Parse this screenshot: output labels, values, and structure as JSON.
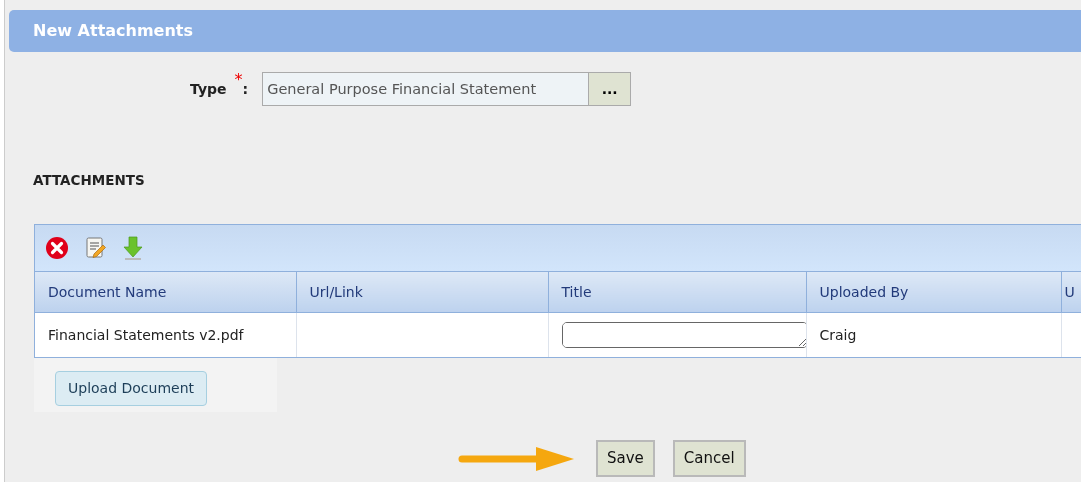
{
  "panel": {
    "title": "New Attachments"
  },
  "type_field": {
    "label": "Type",
    "required_mark": "*",
    "colon": ":",
    "value": "General Purpose Financial Statement",
    "browse_button": "..."
  },
  "attachments": {
    "heading": "ATTACHMENTS",
    "toolbar": [
      {
        "kind": "delete"
      },
      {
        "kind": "edit"
      },
      {
        "kind": "download"
      }
    ],
    "columns": [
      "Document Name",
      "Url/Link",
      "Title",
      "Uploaded By",
      "U"
    ],
    "rows": [
      {
        "document_name": "Financial Statements v2.pdf",
        "url": "",
        "title": "",
        "uploaded_by": "Craig"
      }
    ],
    "upload_button": "Upload Document"
  },
  "buttons": [
    "Save",
    "Cancel"
  ]
}
